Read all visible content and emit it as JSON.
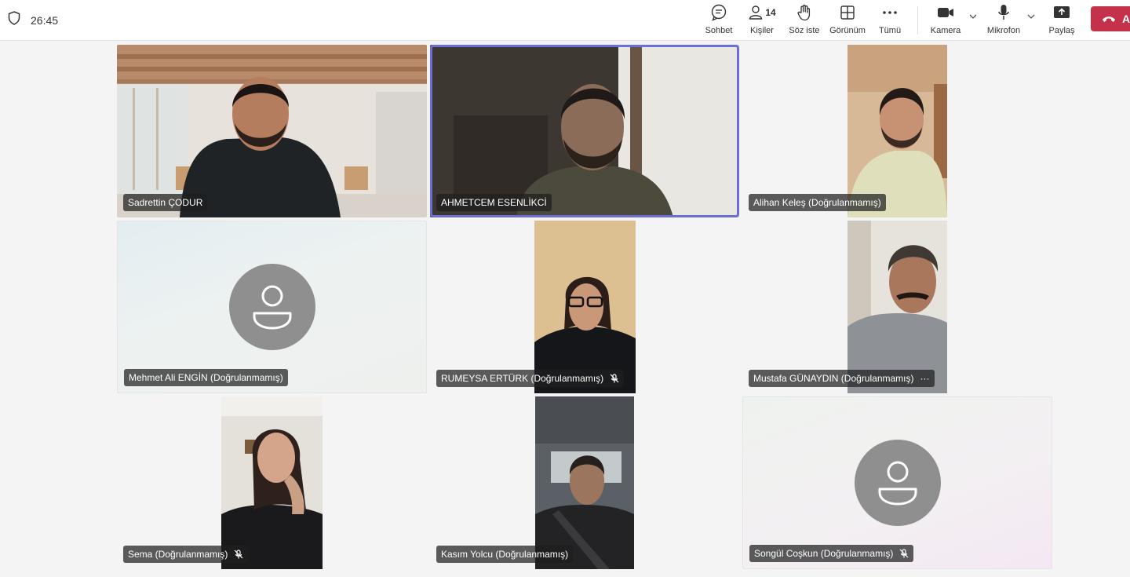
{
  "topbar": {
    "timer": "26:45",
    "people_count": "14",
    "buttons": {
      "chat": "Sohbet",
      "people": "Kişiler",
      "raise_hand": "Söz iste",
      "view": "Görünüm",
      "more": "Tümü",
      "camera": "Kamera",
      "mic": "Mikrofon",
      "share": "Paylaş"
    },
    "leave_label": "A"
  },
  "accent_color": "#6b6fd4",
  "leave_color": "#c4314b",
  "participants": [
    {
      "name": "Sadrettin ÇODUR",
      "video": true,
      "muted": false,
      "active_speaker": false
    },
    {
      "name": "AHMETCEM ESENLİKCİ",
      "video": true,
      "muted": false,
      "active_speaker": true
    },
    {
      "name": "Alihan Keleş (Doğrulanmamış)",
      "video": true,
      "muted": false,
      "active_speaker": false
    },
    {
      "name": "Mehmet Ali ENGİN (Doğrulanmamış)",
      "video": false,
      "muted": false,
      "active_speaker": false
    },
    {
      "name": "RUMEYSA ERTÜRK (Doğrulanmamış)",
      "video": true,
      "muted": true,
      "active_speaker": false
    },
    {
      "name": "Mustafa GÜNAYDIN (Doğrulanmamış)",
      "video": true,
      "muted": false,
      "more": "···",
      "active_speaker": false
    },
    {
      "name": "Sema (Doğrulanmamış)",
      "video": true,
      "muted": true,
      "active_speaker": false
    },
    {
      "name": "Kasım Yolcu (Doğrulanmamış)",
      "video": true,
      "muted": false,
      "active_speaker": false
    },
    {
      "name": "Songül Coşkun (Doğrulanmamış)",
      "video": false,
      "muted": true,
      "active_speaker": false
    }
  ]
}
